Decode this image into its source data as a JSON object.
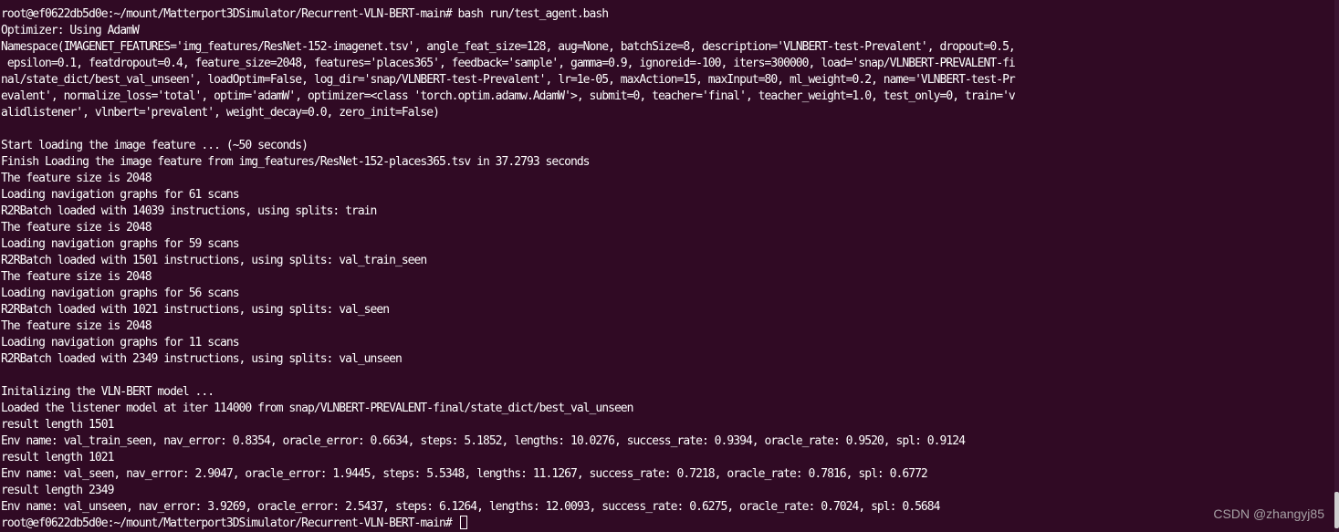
{
  "terminal": {
    "lines": [
      "root@ef0622db5d0e:~/mount/Matterport3DSimulator/Recurrent-VLN-BERT-main# bash run/test_agent.bash",
      "Optimizer: Using AdamW",
      "Namespace(IMAGENET_FEATURES='img_features/ResNet-152-imagenet.tsv', angle_feat_size=128, aug=None, batchSize=8, description='VLNBERT-test-Prevalent', dropout=0.5,",
      " epsilon=0.1, featdropout=0.4, feature_size=2048, features='places365', feedback='sample', gamma=0.9, ignoreid=-100, iters=300000, load='snap/VLNBERT-PREVALENT-fi",
      "nal/state_dict/best_val_unseen', loadOptim=False, log_dir='snap/VLNBERT-test-Prevalent', lr=1e-05, maxAction=15, maxInput=80, ml_weight=0.2, name='VLNBERT-test-Pr",
      "evalent', normalize_loss='total', optim='adamW', optimizer=<class 'torch.optim.adamw.AdamW'>, submit=0, teacher='final', teacher_weight=1.0, test_only=0, train='v",
      "alidlistener', vlnbert='prevalent', weight_decay=0.0, zero_init=False)",
      "",
      "Start loading the image feature ... (~50 seconds)",
      "Finish Loading the image feature from img_features/ResNet-152-places365.tsv in 37.2793 seconds",
      "The feature size is 2048",
      "Loading navigation graphs for 61 scans",
      "R2RBatch loaded with 14039 instructions, using splits: train",
      "The feature size is 2048",
      "Loading navigation graphs for 59 scans",
      "R2RBatch loaded with 1501 instructions, using splits: val_train_seen",
      "The feature size is 2048",
      "Loading navigation graphs for 56 scans",
      "R2RBatch loaded with 1021 instructions, using splits: val_seen",
      "The feature size is 2048",
      "Loading navigation graphs for 11 scans",
      "R2RBatch loaded with 2349 instructions, using splits: val_unseen",
      "",
      "Initalizing the VLN-BERT model ...",
      "Loaded the listener model at iter 114000 from snap/VLNBERT-PREVALENT-final/state_dict/best_val_unseen",
      "result length 1501",
      "Env name: val_train_seen, nav_error: 0.8354, oracle_error: 0.6634, steps: 5.1852, lengths: 10.0276, success_rate: 0.9394, oracle_rate: 0.9520, spl: 0.9124",
      "result length 1021",
      "Env name: val_seen, nav_error: 2.9047, oracle_error: 1.9445, steps: 5.5348, lengths: 11.1267, success_rate: 0.7218, oracle_rate: 0.7816, spl: 0.6772",
      "result length 2349",
      "Env name: val_unseen, nav_error: 3.9269, oracle_error: 2.5437, steps: 6.1264, lengths: 12.0093, success_rate: 0.6275, oracle_rate: 0.7024, spl: 0.5684"
    ],
    "prompt": "root@ef0622db5d0e:~/mount/Matterport3DSimulator/Recurrent-VLN-BERT-main# "
  },
  "watermark": "CSDN @zhangyj85",
  "colors": {
    "background": "#300a24",
    "text": "#ffffff"
  }
}
